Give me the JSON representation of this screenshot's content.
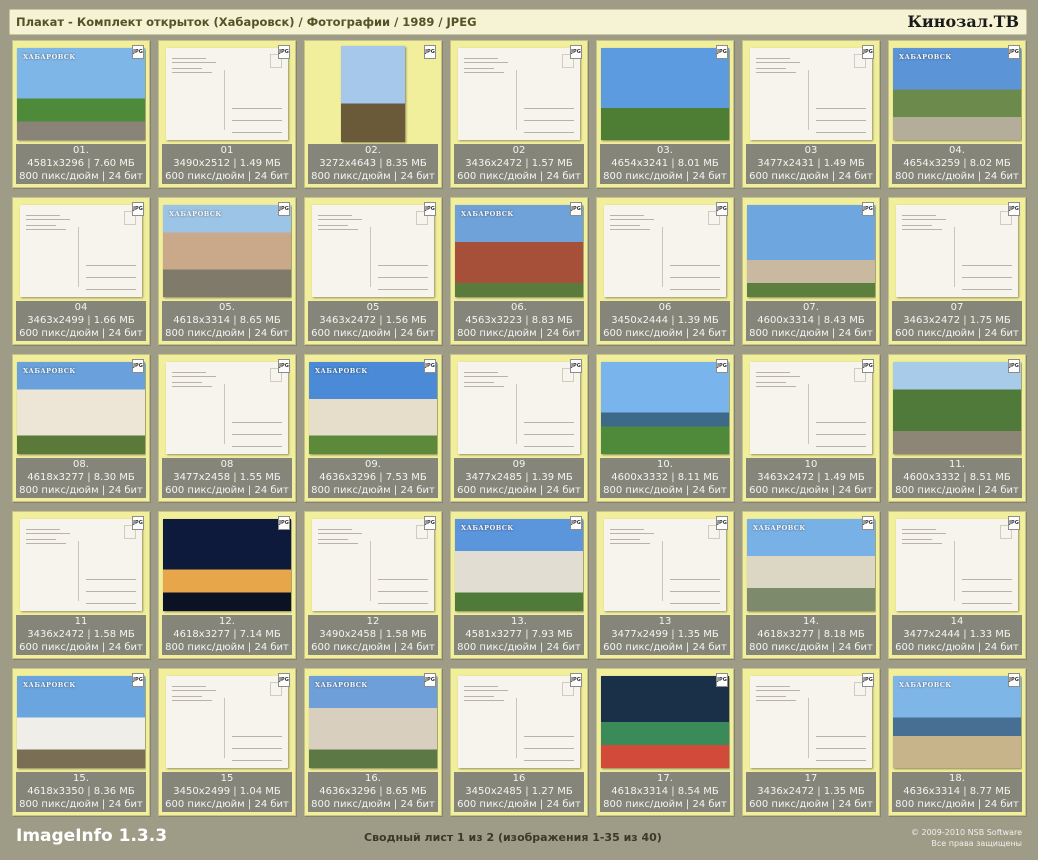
{
  "header": {
    "title": "Плакат - Комплект открыток (Хабаровск) / Фотографии / 1989 / JPEG",
    "brand": "Кинозал.ТВ"
  },
  "icons": {
    "file_type": "JPG"
  },
  "colors": {
    "background": "#9e9c86",
    "tile": "#f1ef9c",
    "info_bar": "#85857a",
    "header_bg": "#f5f3d3"
  },
  "tiles": [
    {
      "label": "01.",
      "dims": "4581x3296 | 7.60 МБ",
      "meta": "800 пикс/дюйм | 24 бит",
      "kind": "photo",
      "city": "ХАБАРОВСК",
      "scene": "monument"
    },
    {
      "label": "01",
      "dims": "3490x2512 | 1.49 МБ",
      "meta": "600 пикс/дюйм | 24 бит",
      "kind": "back"
    },
    {
      "label": "02.",
      "dims": "3272x4643 | 8.35 МБ",
      "meta": "800 пикс/дюйм | 24 бит",
      "kind": "portrait",
      "scene": "statue"
    },
    {
      "label": "02",
      "dims": "3436x2472 | 1.57 МБ",
      "meta": "600 пикс/дюйм | 24 бит",
      "kind": "back"
    },
    {
      "label": "03.",
      "dims": "4654x3241 | 8.01 МБ",
      "meta": "800 пикс/дюйм | 24 бит",
      "kind": "photo",
      "scene": "obelisk"
    },
    {
      "label": "03",
      "dims": "3477x2431 | 1.49 МБ",
      "meta": "600 пикс/дюйм | 24 бит",
      "kind": "back"
    },
    {
      "label": "04.",
      "dims": "4654x3259 | 8.02 МБ",
      "meta": "800 пикс/дюйм | 24 бит",
      "kind": "photo",
      "city": "ХАБАРОВСК",
      "scene": "square"
    },
    {
      "label": "04",
      "dims": "3463x2499 | 1.66 МБ",
      "meta": "600 пикс/дюйм | 24 бит",
      "kind": "back"
    },
    {
      "label": "05.",
      "dims": "4618x3314 | 8.65 МБ",
      "meta": "800 пикс/дюйм | 24 бит",
      "kind": "photo",
      "city": "ХАБАРОВСК",
      "scene": "avenue"
    },
    {
      "label": "05",
      "dims": "3463x2472 | 1.56 МБ",
      "meta": "600 пикс/дюйм | 24 бит",
      "kind": "back"
    },
    {
      "label": "06.",
      "dims": "4563x3223 | 8.83 МБ",
      "meta": "800 пикс/дюйм | 24 бит",
      "kind": "photo",
      "city": "ХАБАРОВСК",
      "scene": "memorial"
    },
    {
      "label": "06",
      "dims": "3450x2444 | 1.39 МБ",
      "meta": "600 пикс/дюйм | 24 бит",
      "kind": "back"
    },
    {
      "label": "07.",
      "dims": "4600x3314 | 8.43 МБ",
      "meta": "800 пикс/дюйм | 24 бит",
      "kind": "photo",
      "scene": "plane"
    },
    {
      "label": "07",
      "dims": "3463x2472 | 1.75 МБ",
      "meta": "600 пикс/дюйм | 24 бит",
      "kind": "back"
    },
    {
      "label": "08.",
      "dims": "4618x3277 | 8.30 МБ",
      "meta": "800 пикс/дюйм | 24 бит",
      "kind": "photo",
      "city": "ХАБАРОВСК",
      "scene": "columns"
    },
    {
      "label": "08",
      "dims": "3477x2458 | 1.55 МБ",
      "meta": "600 пикс/дюйм | 24 бит",
      "kind": "back"
    },
    {
      "label": "09.",
      "dims": "4636x3296 | 7.53 МБ",
      "meta": "800 пикс/дюйм | 24 бит",
      "kind": "photo",
      "city": "ХАБАРОВСК",
      "scene": "theater"
    },
    {
      "label": "09",
      "dims": "3477x2485 | 1.39 МБ",
      "meta": "600 пикс/дюйм | 24 бит",
      "kind": "back"
    },
    {
      "label": "10.",
      "dims": "4600x3332 | 8.11 МБ",
      "meta": "800 пикс/дюйм | 24 бит",
      "kind": "photo",
      "scene": "boat"
    },
    {
      "label": "10",
      "dims": "3463x2472 | 1.49 МБ",
      "meta": "600 пикс/дюйм | 24 бит",
      "kind": "back"
    },
    {
      "label": "11.",
      "dims": "4600x3332 | 8.51 МБ",
      "meta": "800 пикс/дюйм | 24 бит",
      "kind": "photo",
      "scene": "street"
    },
    {
      "label": "11",
      "dims": "3436x2472 | 1.58 МБ",
      "meta": "600 пикс/дюйм | 24 бит",
      "kind": "back"
    },
    {
      "label": "12.",
      "dims": "4618x3277 | 7.14 МБ",
      "meta": "800 пикс/дюйм | 24 бит",
      "kind": "photo",
      "scene": "night"
    },
    {
      "label": "12",
      "dims": "3490x2458 | 1.58 МБ",
      "meta": "600 пикс/дюйм | 24 бит",
      "kind": "back"
    },
    {
      "label": "13.",
      "dims": "4581x3277 | 7.93 МБ",
      "meta": "800 пикс/дюйм | 24 бит",
      "kind": "photo",
      "city": "ХАБАРОВСК",
      "scene": "hotel"
    },
    {
      "label": "13",
      "dims": "3477x2499 | 1.35 МБ",
      "meta": "600 пикс/дюйм | 24 бит",
      "kind": "back"
    },
    {
      "label": "14.",
      "dims": "4618x3277 | 8.18 МБ",
      "meta": "800 пикс/дюйм | 24 бит",
      "kind": "photo",
      "city": "ХАБАРОВСК",
      "scene": "modern"
    },
    {
      "label": "14",
      "dims": "3477x2444 | 1.33 МБ",
      "meta": "600 пикс/дюйм | 24 бит",
      "kind": "back"
    },
    {
      "label": "15.",
      "dims": "4618x3350 | 8.36 МБ",
      "meta": "800 пикс/дюйм | 24 бит",
      "kind": "photo",
      "city": "ХАБАРОВСК",
      "scene": "arch"
    },
    {
      "label": "15",
      "dims": "3450x2499 | 1.04 МБ",
      "meta": "600 пикс/дюйм | 24 бит",
      "kind": "back"
    },
    {
      "label": "16.",
      "dims": "4636x3296 | 8.65 МБ",
      "meta": "800 пикс/дюйм | 24 бит",
      "kind": "photo",
      "city": "ХАБАРОВСК",
      "scene": "tower"
    },
    {
      "label": "16",
      "dims": "3450x2485 | 1.27 МБ",
      "meta": "600 пикс/дюйм | 24 бит",
      "kind": "back"
    },
    {
      "label": "17.",
      "dims": "4618x3314 | 8.54 МБ",
      "meta": "800 пикс/дюйм | 24 бит",
      "kind": "photo",
      "scene": "hydrofoil"
    },
    {
      "label": "17",
      "dims": "3436x2472 | 1.35 МБ",
      "meta": "600 пикс/дюйм | 24 бит",
      "kind": "back"
    },
    {
      "label": "18.",
      "dims": "4636x3314 | 8.77 МБ",
      "meta": "800 пикс/дюйм | 24 бит",
      "kind": "photo",
      "city": "ХАБАРОВСК",
      "scene": "beach"
    }
  ],
  "footer": {
    "app_name": "ImageInfo 1.3.3",
    "summary": "Сводный лист 1 из 2 (изображения 1-35 из 40)",
    "copyright": "© 2009-2010 NSB Software",
    "rights": "Все права защищены"
  }
}
